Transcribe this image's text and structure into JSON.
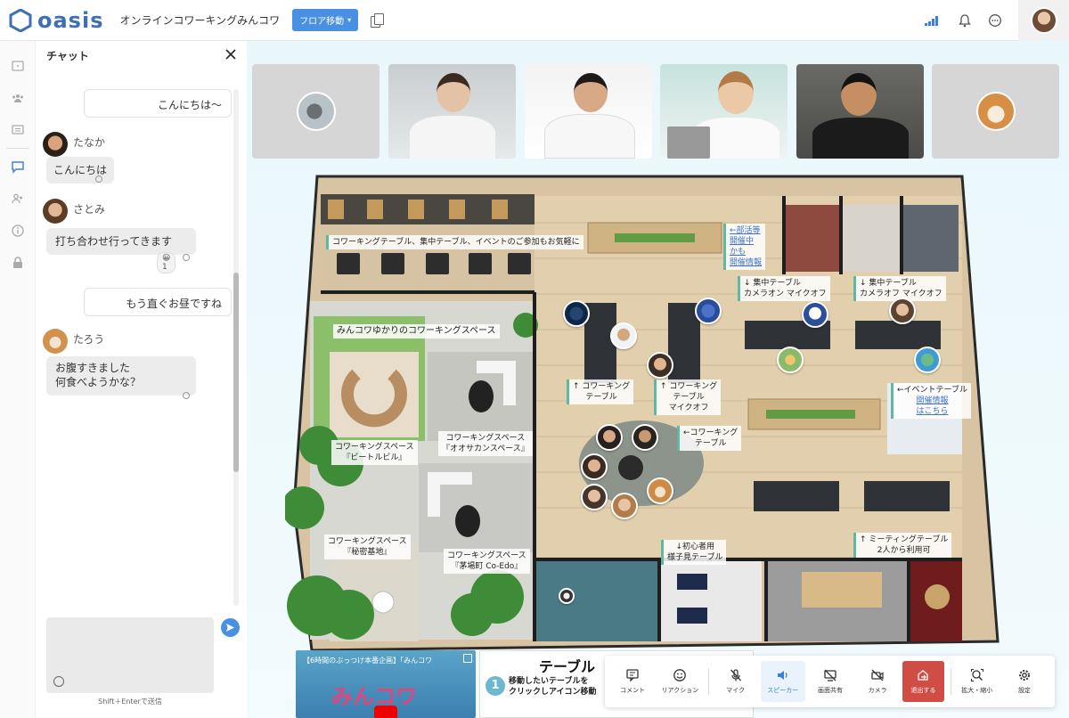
{
  "topbar": {
    "logo_text": "oasis",
    "space_name": "オンラインコワーキングみんコワ",
    "floor_button": "フロア移動"
  },
  "chat": {
    "title": "チャット",
    "messages": [
      {
        "own": true,
        "text": "こんにちは〜"
      },
      {
        "name": "たなか",
        "text": "こんにちは"
      },
      {
        "name": "さとみ",
        "text": "打ち合わせ行ってきます",
        "reaction": "😀 1"
      },
      {
        "own": true,
        "text": "もう直ぐお昼ですね"
      },
      {
        "name": "たろう",
        "text_line1": "お腹すきました",
        "text_line2": "何食べようかな？"
      }
    ],
    "input_hint": "Shift＋Enterで送信"
  },
  "floor": {
    "labels": {
      "top_table": "コワーキングテーブル、集中テーブル、イベントのご参加もお気軽に",
      "yukari": "みんコワゆかりのコワーキングスペース",
      "beetle_1": "コワーキングスペース",
      "beetle_2": "『ビートルビル』",
      "osaka_1": "コワーキングスペース",
      "osaka_2": "『オオサカンスペース』",
      "himitsu_1": "コワーキングスペース",
      "himitsu_2": "『秘密基地』",
      "codo_1": "コワーキングスペース",
      "codo_2": "『茅場町 Co-Edo』",
      "bukatsu_1": "←部活等",
      "bukatsu_2": "開催中",
      "bukatsu_3": "かも",
      "bukatsu_4": "開催情報",
      "focus1_1": "↓ 集中テーブル",
      "focus1_2": "カメラオン マイクオフ",
      "focus2_1": "↓ 集中テーブル",
      "focus2_2": "カメラオフ マイクオフ",
      "cw1_1": "↑ コワーキング",
      "cw1_2": "テーブル",
      "cw2_1": "↑ コワーキング",
      "cw2_2": "テーブル",
      "cw2_3": "マイクオフ",
      "event_1": "←イベントテーブル",
      "event_2": "開催情報",
      "event_3": "はこちら",
      "cw3_1": "←コワーキング",
      "cw3_2": "テーブル",
      "beginner_1": "↓初心者用",
      "beginner_2": "様子見テーブル",
      "meeting_1": "↑ ミーティングテーブル",
      "meeting_2": "2人から利用可"
    }
  },
  "video_card": {
    "title": "【6時間のぶっつけ本番企画】「みんコワ",
    "logo": "みんコワ"
  },
  "howto_card": {
    "title": "テーブル",
    "step": "1",
    "text_line1": "移動したいテーブルを",
    "text_line2": "クリックしアイコン移動"
  },
  "toolbar": {
    "items": [
      {
        "label": "コメント",
        "icon": "comment-icon"
      },
      {
        "label": "リアクション",
        "icon": "smile-icon"
      },
      {
        "label": "マイク",
        "icon": "mic-off-icon"
      },
      {
        "label": "スピーカー",
        "icon": "speaker-icon"
      },
      {
        "label": "画面共有",
        "icon": "screen-share-off-icon"
      },
      {
        "label": "カメラ",
        "icon": "camera-off-icon"
      },
      {
        "label": "退出する",
        "icon": "exit-icon"
      },
      {
        "label": "拡大・縮小",
        "icon": "zoom-icon"
      },
      {
        "label": "設定",
        "icon": "gear-icon"
      }
    ]
  },
  "colors": {
    "accent": "#4a90e2",
    "brand": "#3f6fb5",
    "exit": "#cf4d45",
    "speaker_active": "#3b7fd7"
  }
}
